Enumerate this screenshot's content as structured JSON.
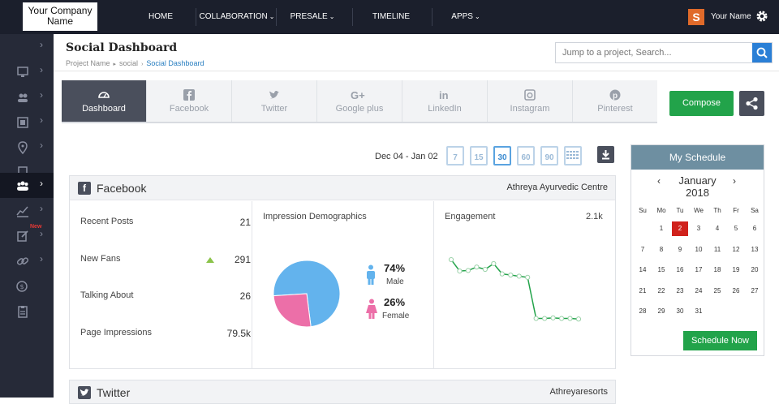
{
  "company": "Your Company Name",
  "nav": {
    "items": [
      "HOME",
      "COLLABORATION",
      "PRESALE",
      "TIMELINE",
      "APPS"
    ]
  },
  "user": {
    "initial": "S",
    "name": "Your Name"
  },
  "header": {
    "title": "Social Dashboard",
    "breadcrumb": [
      "Project Name",
      "social",
      "Social Dashboard"
    ],
    "search_placeholder": "Jump to a project, Search..."
  },
  "sidebar": {
    "new_badge": "New"
  },
  "tabs": [
    "Dashboard",
    "Facebook",
    "Twitter",
    "Google plus",
    "LinkedIn",
    "Instagram",
    "Pinterest"
  ],
  "compose_label": "Compose",
  "date_range": "Dec 04 - Jan 02",
  "day_options": [
    "7",
    "15",
    "30",
    "60",
    "90"
  ],
  "facebook": {
    "title": "Facebook",
    "account": "Athreya Ayurvedic Centre",
    "stats": [
      {
        "label": "Recent Posts",
        "value": "21"
      },
      {
        "label": "New Fans",
        "value": "291"
      },
      {
        "label": "Talking About",
        "value": "26"
      },
      {
        "label": "Page Impressions",
        "value": "79.5k"
      }
    ],
    "demographics": {
      "title": "Impression Demographics",
      "male_pct": "74%",
      "male_label": "Male",
      "female_pct": "26%",
      "female_label": "Female"
    },
    "engagement": {
      "title": "Engagement",
      "value": "2.1k"
    }
  },
  "twitter": {
    "title": "Twitter",
    "account": "Athreyaresorts"
  },
  "schedule": {
    "title": "My Schedule",
    "month": "January",
    "year": "2018",
    "weekdays": [
      "Su",
      "Mo",
      "Tu",
      "We",
      "Th",
      "Fr",
      "Sa"
    ],
    "weeks": [
      [
        "",
        "1",
        "2",
        "3",
        "4",
        "5",
        "6"
      ],
      [
        "7",
        "8",
        "9",
        "10",
        "11",
        "12",
        "13"
      ],
      [
        "14",
        "15",
        "16",
        "17",
        "18",
        "19",
        "20"
      ],
      [
        "21",
        "22",
        "23",
        "24",
        "25",
        "26",
        "27"
      ],
      [
        "28",
        "29",
        "30",
        "31",
        "",
        "",
        ""
      ]
    ],
    "today": "2",
    "button": "Schedule Now"
  },
  "colors": {
    "accent_green": "#22a34a",
    "accent_blue": "#2a7fd6",
    "today_red": "#d0221c",
    "male_blue": "#63b3ed",
    "female_pink": "#ec6fa8"
  },
  "chart_data": [
    {
      "type": "pie",
      "title": "Impression Demographics",
      "categories": [
        "Male",
        "Female"
      ],
      "values": [
        74,
        26
      ]
    },
    {
      "type": "line",
      "title": "Engagement",
      "values": [
        1.75,
        1.55,
        1.56,
        1.62,
        1.58,
        1.68,
        1.5,
        1.48,
        1.46,
        1.44,
        0.72,
        0.72,
        0.73,
        0.72,
        0.72,
        0.71
      ]
    }
  ]
}
